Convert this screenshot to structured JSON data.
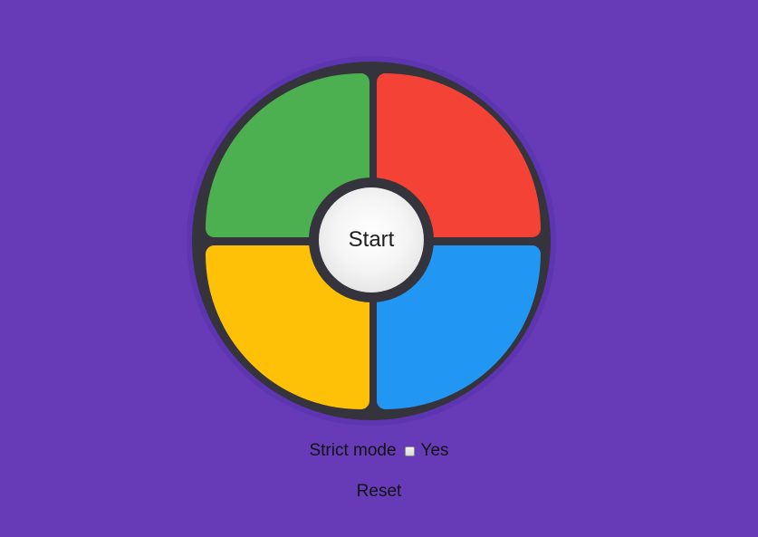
{
  "game": {
    "pads": [
      {
        "name": "green",
        "color": "#4caf50"
      },
      {
        "name": "red",
        "color": "#f44336"
      },
      {
        "name": "yellow",
        "color": "#ffc107"
      },
      {
        "name": "blue",
        "color": "#2196f3"
      }
    ],
    "start_label": "Start"
  },
  "controls": {
    "strict_label": "Strict mode",
    "strict_checked": false,
    "strict_option": "Yes",
    "reset_label": "Reset"
  },
  "theme": {
    "background": "#673ab7",
    "board": "#35333b"
  }
}
